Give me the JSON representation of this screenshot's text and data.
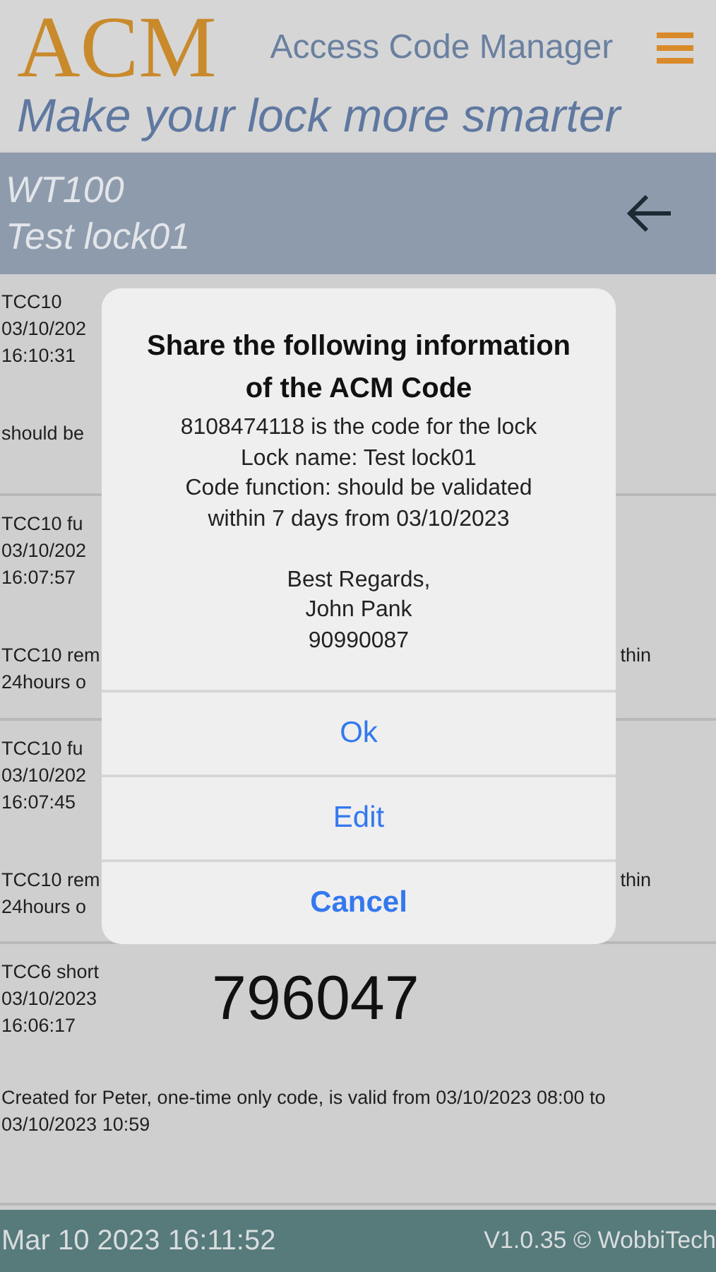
{
  "header": {
    "logo": "ACM",
    "app_name": "Access Code Manager",
    "tagline": "Make your lock more smarter"
  },
  "lock": {
    "model": "WT100",
    "name": "Test lock01"
  },
  "codes": [
    {
      "name": "TCC10",
      "date": "03/10/202",
      "time": "16:10:31",
      "description": [
        "should be"
      ]
    },
    {
      "name": "TCC10 fu",
      "date": "03/10/202",
      "time": "16:07:57",
      "description": [
        "TCC10 rem",
        "24hours o"
      ],
      "description_tail": "thin"
    },
    {
      "name": "TCC10 fu",
      "date": "03/10/202",
      "time": "16:07:45",
      "description": [
        "TCC10 rem",
        "24hours o"
      ],
      "description_tail": "thin"
    },
    {
      "name": "TCC6 short",
      "date": "03/10/2023",
      "time": "16:06:17",
      "code": "796047",
      "description": [
        "Created for Peter, one-time only code, is valid from 03/10/2023 08:00 to 03/10/2023 10:59"
      ]
    }
  ],
  "dialog": {
    "title": "Share the following information of the ACM Code",
    "message": [
      "8108474118 is the code for the lock",
      "Lock name: Test lock01",
      "Code function: should be validated",
      "within 7 days from 03/10/2023"
    ],
    "signature": [
      "Best Regards,",
      "John Pank",
      "90990087"
    ],
    "buttons": [
      {
        "label": "Ok",
        "kind": "default"
      },
      {
        "label": "Edit",
        "kind": "default"
      },
      {
        "label": "Cancel",
        "kind": "cancel"
      }
    ]
  },
  "status_bar": {
    "datetime": "Mar 10 2023 16:11:52",
    "version": "V1.0.35 © WobbiTech"
  }
}
